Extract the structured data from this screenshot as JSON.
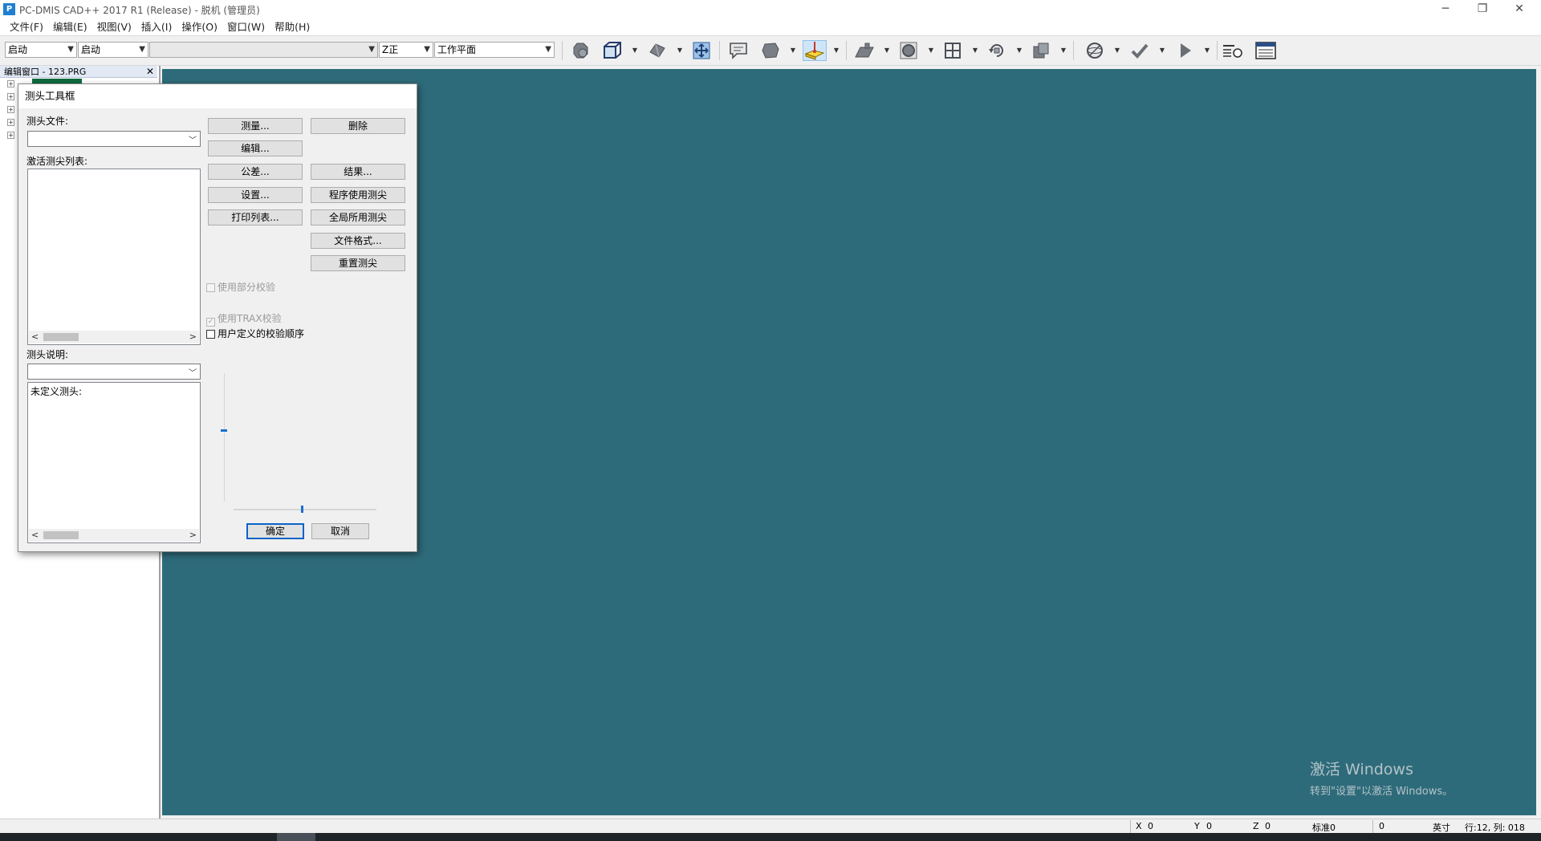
{
  "window": {
    "app_icon": "P",
    "title": "PC-DMIS CAD++ 2017 R1 (Release) - 脱机 (管理员)",
    "minimize": "─",
    "restore": "❐",
    "close": "✕"
  },
  "menu": [
    "文件(F)",
    "编辑(E)",
    "视图(V)",
    "插入(I)",
    "操作(O)",
    "窗口(W)",
    "帮助(H)"
  ],
  "toolbar": {
    "combo1": "启动",
    "combo2": "启动",
    "combo3": "",
    "combo4": "Z正",
    "combo5": "工作平面",
    "icons": [
      "probe-mode-icon",
      "view-setup-icon",
      "solid-view-icon",
      "zoom-to-fit-icon",
      "comment-icon",
      "shape-icon",
      "probe-toolbox-icon",
      "plane-icon",
      "circle-icon",
      "grid-view-icon",
      "rotate-icon",
      "copy-icon",
      "sphere-icon",
      "check-icon",
      "run-icon",
      "settings-list-icon",
      "report-icon"
    ]
  },
  "edit_window": {
    "title": "编辑窗口 - 123.PRG",
    "close": "✕"
  },
  "dialog": {
    "title": "测头工具框",
    "probe_file_label": "测头文件:",
    "probe_file_value": "",
    "active_tips_label": "激活测尖列表:",
    "probe_desc_label": "测头说明:",
    "probe_desc_value": "",
    "desc_text": "未定义测头:",
    "buttons": {
      "measure": "测量...",
      "delete": "删除",
      "edit": "编辑...",
      "tolerance": "公差...",
      "results": "结果...",
      "setup": "设置...",
      "program_tips": "程序使用测尖",
      "print_list": "打印列表...",
      "global_tips": "全局所用测尖",
      "file_format": "文件格式...",
      "reset_tips": "重置测尖",
      "ok": "确定",
      "cancel": "取消"
    },
    "checkboxes": {
      "partial_calib": {
        "label": "使用部分校验",
        "checked": false,
        "enabled": false
      },
      "trax_calib": {
        "label": "使用TRAX校验",
        "checked": true,
        "enabled": false
      },
      "user_order": {
        "label": "用户定义的校验顺序",
        "checked": false,
        "enabled": true
      }
    },
    "scroll_left": "<",
    "scroll_right": ">"
  },
  "watermark": {
    "line1": "激活 Windows",
    "line2": "转到\"设置\"以激活 Windows。"
  },
  "status": {
    "x_label": "X",
    "x_value": "0",
    "y_label": "Y",
    "y_value": "0",
    "z_label": "Z",
    "z_value": "0",
    "std": "标准0",
    "field0": "0",
    "unit": "英寸",
    "rowcol": "行:12, 列: 018"
  },
  "colors": {
    "graphics_bg": "#2e6b7a",
    "accent": "#0a64c8"
  }
}
